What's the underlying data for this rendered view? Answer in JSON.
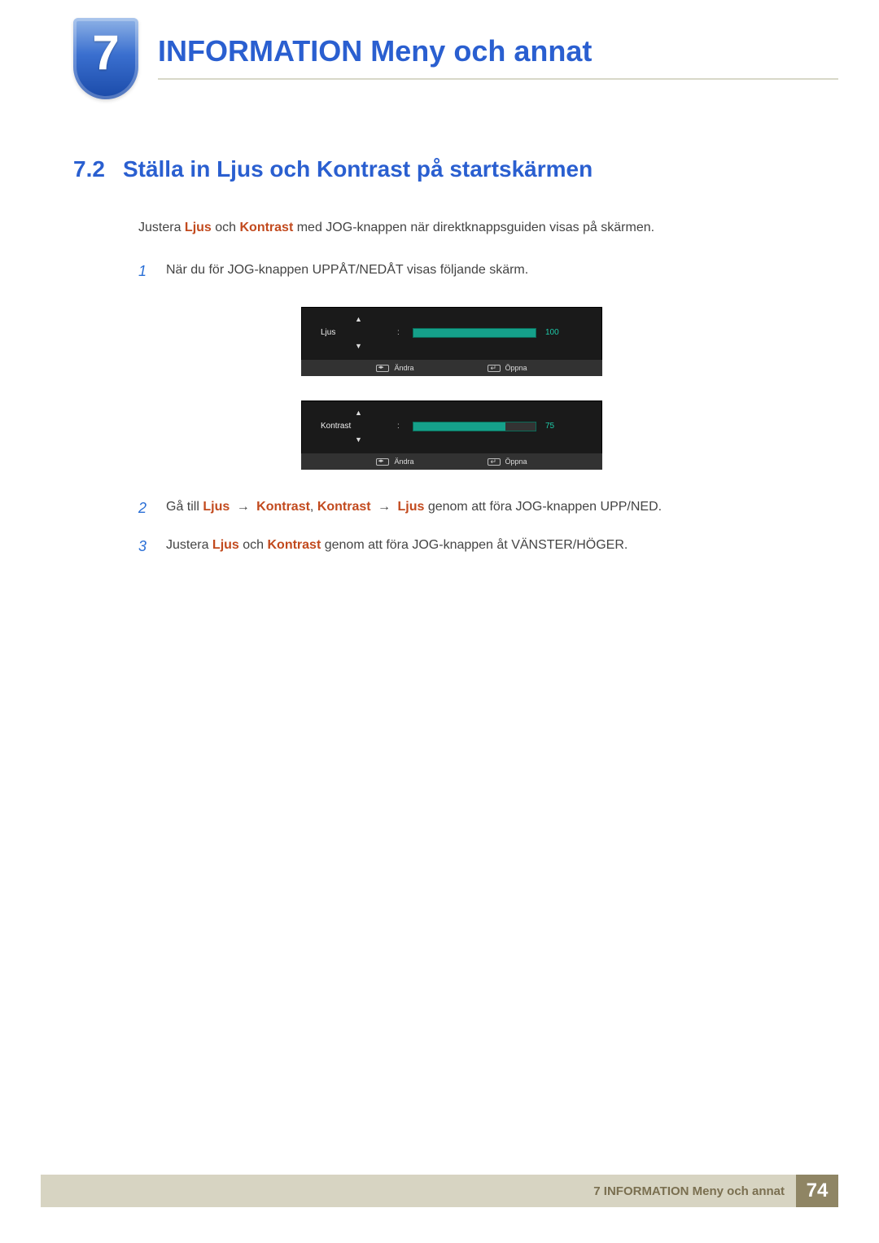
{
  "chapter": {
    "number": "7",
    "title": "INFORMATION Meny och annat"
  },
  "section": {
    "number": "7.2",
    "title": "Ställa in Ljus och Kontrast på startskärmen"
  },
  "intro": {
    "prefix": "Justera ",
    "hl1": "Ljus",
    "mid": " och ",
    "hl2": "Kontrast",
    "suffix": " med JOG-knappen när direktknappsguiden visas på skärmen."
  },
  "steps": {
    "s1": {
      "num": "1",
      "text": "När du för JOG-knappen UPPÅT/NEDÅT visas följande skärm."
    },
    "s2": {
      "num": "2",
      "prefix": "Gå till ",
      "hl1": "Ljus",
      "arrow1": "→",
      "hl2": "Kontrast",
      "comma": ", ",
      "hl3": "Kontrast",
      "arrow2": "→",
      "hl4": "Ljus",
      "suffix": " genom att föra JOG-knappen UPP/NED."
    },
    "s3": {
      "num": "3",
      "prefix": "Justera ",
      "hl1": "Ljus",
      "mid": " och ",
      "hl2": "Kontrast",
      "suffix": " genom att föra JOG-knappen åt VÄNSTER/HÖGER."
    }
  },
  "osd": {
    "panel1": {
      "label": "Ljus",
      "value": "100",
      "fillPct": 100
    },
    "panel2": {
      "label": "Kontrast",
      "value": "75",
      "fillPct": 75
    },
    "footer": {
      "change": "Ändra",
      "open": "Öppna"
    },
    "upGlyph": "▲",
    "downGlyph": "▼"
  },
  "footer": {
    "text": "7 INFORMATION Meny och annat",
    "page": "74"
  }
}
